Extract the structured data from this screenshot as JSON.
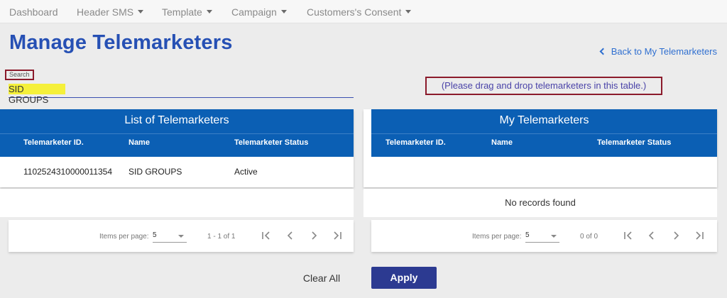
{
  "nav": {
    "items": [
      {
        "label": "Dashboard",
        "dropdown": false
      },
      {
        "label": "Header SMS",
        "dropdown": true
      },
      {
        "label": "Template",
        "dropdown": true
      },
      {
        "label": "Campaign",
        "dropdown": true
      },
      {
        "label": "Customers's Consent",
        "dropdown": true
      }
    ]
  },
  "header": {
    "title": "Manage Telemarketers",
    "back_link": "Back to My Telemarketers"
  },
  "search": {
    "label": "Search",
    "value": "SID GROUPS"
  },
  "drag_hint": "(Please drag and drop telemarketers in this table.)",
  "left_table": {
    "title": "List of Telemarketers",
    "columns": [
      "Telemarketer ID.",
      "Name",
      "Telemarketer Status"
    ],
    "rows": [
      [
        "1102524310000011354",
        "SID GROUPS",
        "Active"
      ]
    ],
    "pager": {
      "items_label": "Items per page:",
      "page_size": "5",
      "range": "1 - 1 of 1"
    }
  },
  "right_table": {
    "title": "My Telemarketers",
    "columns": [
      "Telemarketer ID.",
      "Name",
      "Telemarketer Status"
    ],
    "empty_text": "No records found",
    "pager": {
      "items_label": "Items per page:",
      "page_size": "5",
      "range": "0 of 0"
    }
  },
  "actions": {
    "clear_label": "Clear All",
    "apply_label": "Apply"
  },
  "colors": {
    "title_blue": "#2650b4",
    "table_header": "#0b5fb4",
    "apply_button": "#2c3a91",
    "highlight": "#f5f03a",
    "annotation_box": "#8b1a2b"
  }
}
